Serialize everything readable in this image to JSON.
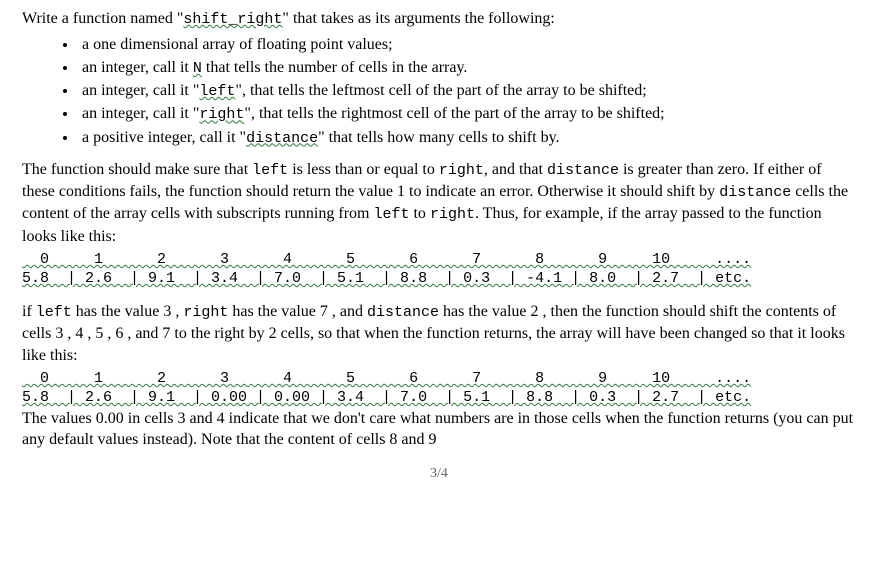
{
  "intro": {
    "pre": "Write a function named \"",
    "fn_name": "shift_right",
    "post": "\" that takes as its arguments the following:"
  },
  "bullets": {
    "b1": "a one dimensional array of floating point values;",
    "b2_pre": "an integer, call it ",
    "b2_code": "N",
    "b2_post": " that tells the number of cells in the array.",
    "b3_pre": "an integer, call it \"",
    "b3_code": "left",
    "b3_post": "\", that tells the leftmost cell of the part of the array to be shifted;",
    "b4_pre": "an integer, call it \"",
    "b4_code": "right",
    "b4_post": "\", that tells the rightmost cell of the part of the array to be shifted;",
    "b5_pre": "a positive integer, call it \"",
    "b5_code": "distance",
    "b5_post": "\" that tells how many cells to shift by."
  },
  "p2": {
    "s1": "The function should make sure that ",
    "c1": "left",
    "s2": " is less than or equal to ",
    "c2": "right",
    "s3": ", and that ",
    "c3": "distance",
    "s4": " is greater than zero. If either of these conditions fails, the function should return the value 1 to indicate an error. Otherwise it should shift by ",
    "c4": "distance",
    "s5": " cells the content of the array cells with subscripts running from ",
    "c5": "left",
    "s6": " to ",
    "c6": "right",
    "s7": ". Thus, for example, if the array passed to the function looks like this:"
  },
  "arr1": {
    "idx": "  0     1      2      3      4      5      6      7      8      9     10     ....",
    "val": "5.8  | 2.6  | 9.1  | 3.4  | 7.0  | 5.1  | 8.8  | 0.3  | -4.1 | 8.0  | 2.7  | etc."
  },
  "p3": {
    "s1": "if ",
    "c1": "left",
    "s2": " has the value 3 , ",
    "c2": "right",
    "s3": " has the value 7 , and ",
    "c3": "distance",
    "s4": " has the value 2 , then the function should shift the contents of cells 3 , 4 , 5 , 6 , and 7 to the right by 2 cells, so that when the function returns, the array will have been changed so that it looks like this:"
  },
  "arr2": {
    "idx": "  0     1      2      3      4      5      6      7      8      9     10     ....",
    "val": "5.8  | 2.6  | 9.1  | 0.00 | 0.00 | 3.4  | 7.0  | 5.1  | 8.8  | 0.3  | 2.7  | etc."
  },
  "p4": "The values 0.00 in cells 3 and 4 indicate that we don't care what numbers are in those cells when the function returns (you can put any default values instead). Note that the content of cells 8 and 9",
  "page_num": "3/4"
}
